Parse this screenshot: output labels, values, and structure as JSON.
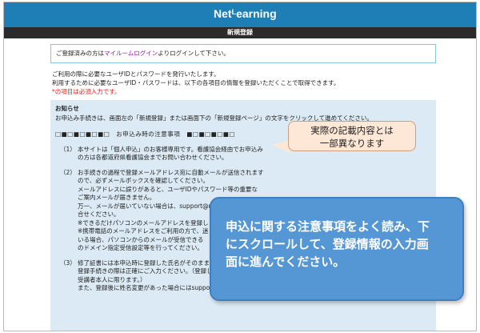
{
  "header": {
    "logo_main": "Net",
    "logo_sup": "L",
    "logo_tail": "earning"
  },
  "titlebar": {
    "title": "新規登録"
  },
  "login": {
    "prefix": "ご登録済みの方は",
    "link": "マイルームログイン",
    "suffix": "よりログインして下さい。"
  },
  "intro": {
    "line1": "ご利用の際に必要なユーザIDとパスワードを発行いたします。",
    "line2": "利用するために必要なユーザID・パスワードは、以下の各項目の情報を登録いただくことで取得できます。",
    "required": "*の項目は必須入力です。"
  },
  "notice": {
    "heading": "お知らせ",
    "lead": "お申込み手続きは、画面左の「新規登録」または画面下の「新規登録ページ」の文字をクリックして進めてください。",
    "section_title": "□■□■□■□■□　お申込み時の注意事項　■□■□■□■□",
    "items": [
      {
        "num": "（1）",
        "lines": [
          "本サイトは「個人申込」のお客様専用です。看護協会経由でお申込み",
          "の方は各都道府県看護協会までお問い合わせください。"
        ]
      },
      {
        "num": "（2）",
        "lines": [
          "お手続きの過程で登録メールアドレス宛に自動メールが送信されます",
          "ので、必ずメールボックスを確認してください。",
          "メールアドレスに誤りがあると、ユーザIDやパスワード等の重要な",
          "ご案内メールが届きません。",
          "万一、メールが届いていない場合は、support@ne",
          "合せください。",
          "※できるだけパソコンのメールアドレスを登録し",
          "※携帯電話のメールアドレスをご利用の方で、迷",
          "いる場合、パソコンからのメールが受信できる",
          "のドメイン指定受信設定等を行ってください。"
        ]
      },
      {
        "num": "（3）",
        "lines": [
          "修了証書には本申込時に登録した氏名がそのまま使",
          "登録手続きの際は正確にご入力ください。（登録し",
          "受講者本人に限ります。）",
          "また、登録後に姓名変更があった場合にはsupport"
        ]
      }
    ],
    "bottom_line": "□■□■□■□■□■□■□■□■□■□■□■□■□■□■□"
  },
  "callout": {
    "line1": "実際の記載内容とは",
    "line2": "一部異なります"
  },
  "bluebox": {
    "line1": "申込に関する注意事項をよく読み、下",
    "line2": "にスクロールして、登録情報の入力画",
    "line3": "面に進んでください。"
  },
  "colors": {
    "header_blue": "#1d7fb6",
    "titlebar_dark": "#2b2b2b",
    "notice_bg": "#dbeaf4",
    "link_purple": "#8a1e9a",
    "required_red": "#e02020",
    "callout_bg": "#fde7d6",
    "bluebox_bg": "#5596d4"
  }
}
